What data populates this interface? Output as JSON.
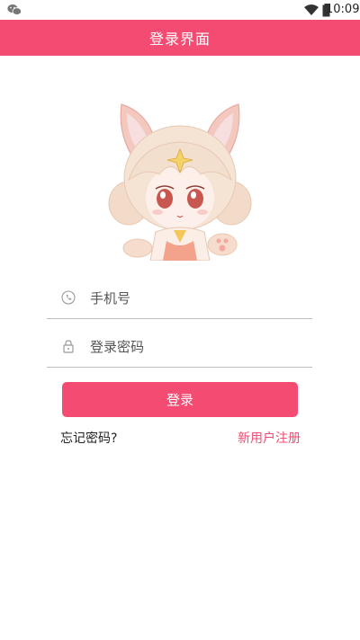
{
  "status_bar": {
    "time": "10:09",
    "left_icon": "wechat-icon",
    "signal_icon": "wifi-icon",
    "battery_icon": "battery-icon"
  },
  "app_bar": {
    "title": "登录界面",
    "color": "#f34b72"
  },
  "avatar": {
    "icon": "cat-girl-avatar"
  },
  "form": {
    "phone": {
      "placeholder": "手机号",
      "value": "",
      "icon": "phone-icon"
    },
    "password": {
      "placeholder": "登录密码",
      "value": "",
      "icon": "lock-icon"
    },
    "login_label": "登录",
    "forgot_label": "忘记密码?",
    "register_label": "新用户注册"
  },
  "colors": {
    "accent": "#f34b72",
    "divider": "#bdbdbd",
    "text": "#222222"
  }
}
